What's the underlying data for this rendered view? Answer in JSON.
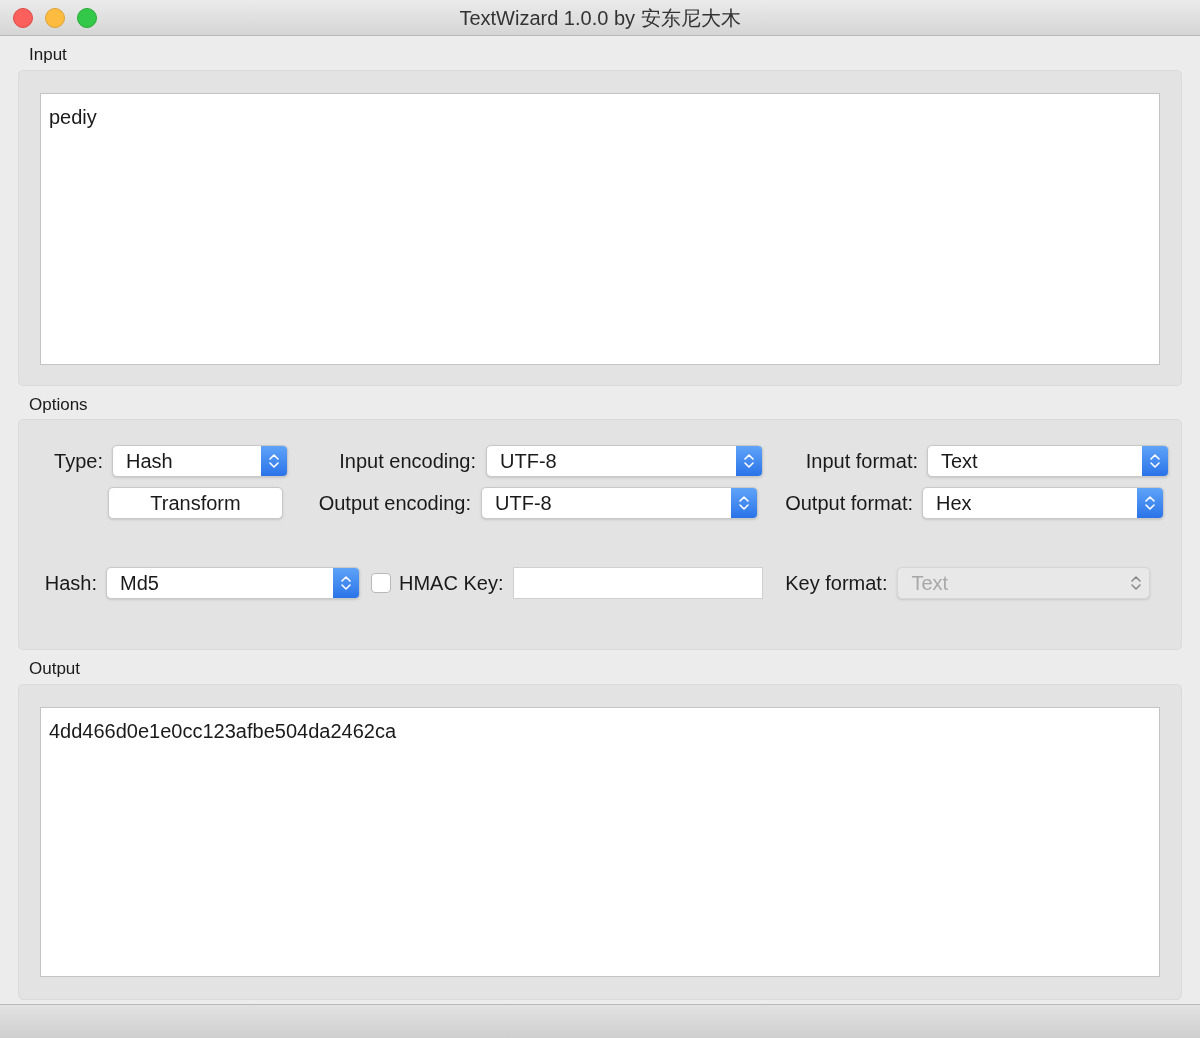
{
  "window": {
    "title": "TextWizard 1.0.0 by 安东尼大木"
  },
  "input": {
    "label": "Input",
    "value": "pediy"
  },
  "options": {
    "label": "Options",
    "type": {
      "label": "Type:",
      "value": "Hash",
      "disabled": false
    },
    "transform_button": "Transform",
    "input_encoding": {
      "label": "Input encoding:",
      "value": "UTF-8",
      "disabled": false
    },
    "output_encoding": {
      "label": "Output encoding:",
      "value": "UTF-8",
      "disabled": false
    },
    "input_format": {
      "label": "Input format:",
      "value": "Text",
      "disabled": false
    },
    "output_format": {
      "label": "Output format:",
      "value": "Hex",
      "disabled": false
    },
    "hash": {
      "label": "Hash:",
      "value": "Md5",
      "disabled": false
    },
    "hmac": {
      "label": "HMAC Key:",
      "checked": false
    },
    "key_format": {
      "label": "Key format:",
      "value": "Text",
      "disabled": true
    }
  },
  "output": {
    "label": "Output",
    "value": "4dd466d0e1e0cc123afbe504da2462ca"
  }
}
